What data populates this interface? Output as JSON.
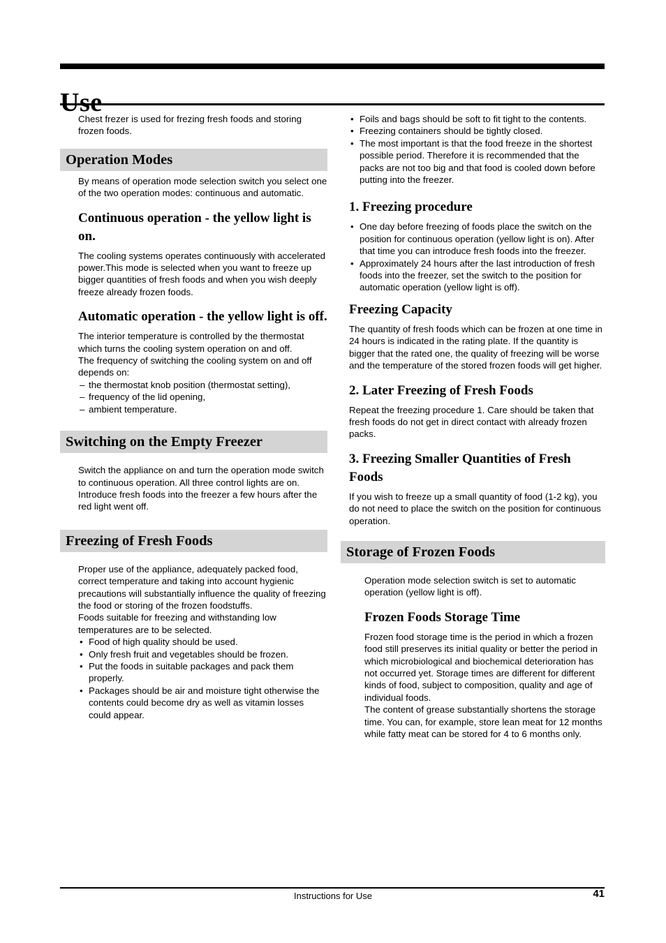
{
  "document": {
    "title": "Use",
    "footer": {
      "center": "Instructions for Use",
      "page_number": "41"
    }
  },
  "left_column": {
    "intro": "Chest frezer is used for frezing fresh foods and storing frozen foods.",
    "section_operation_modes": {
      "heading": "Operation Modes",
      "intro": "By means of operation mode selection switch you select one of the two operation modes: continuous and automatic.",
      "sub_continuous": {
        "heading": "Continuous operation - the yellow light is on.",
        "body": "The cooling systems operates continuously with accelerated power.This mode is selected when you want to freeze up bigger quantities of fresh foods and when you wish deeply freeze already frozen foods."
      },
      "sub_automatic": {
        "heading": "Automatic operation - the yellow light is off.",
        "body_1": "The interior temperature is controlled by the thermostat which turns the cooling system operation on and off.",
        "body_2": "The frequency of switching the cooling system on and off depends on:",
        "dashes": [
          "the thermostat knob position (thermostat setting),",
          "frequency of the lid opening,",
          "ambient temperature."
        ]
      }
    },
    "section_switching_on": {
      "heading": "Switching on the Empty Freezer",
      "body": "Switch the appliance on and turn the operation mode switch to continuous operation. All three control lights are on. Introduce fresh foods into the freezer a few hours after the red light went off."
    },
    "section_freezing_fresh": {
      "heading": "Freezing of Fresh Foods",
      "body_1": "Proper use of the appliance, adequately packed food, correct temperature and taking into account hygienic precautions will substantially influence the quality of freezing the food or storing of the frozen foodstuffs.",
      "body_2": "Foods suitable for freezing and withstanding low temperatures are to be selected.",
      "bullets": [
        "Food of high quality should be used.",
        "Only fresh fruit and vegetables should be frozen.",
        "Put the foods in suitable packages and pack them properly.",
        "Packages should be air and moisture tight otherwise the contents could become dry as well as vitamin losses could appear."
      ]
    }
  },
  "right_column": {
    "top_bullets": [
      "Foils and bags should be soft to fit tight to the contents.",
      "Freezing containers should be tightly closed.",
      "The most important is that the food freeze in the shortest possible period. Therefore it is recommended that the packs are not too big and that food is cooled down before putting into the freezer."
    ],
    "section_freezing_procedure": {
      "heading": "1. Freezing procedure",
      "bullets": [
        "One day before freezing of foods place the switch on the position for continuous operation (yellow light is on). After that time you can introduce fresh foods into the freezer.",
        "Approximately 24 hours after the last introduction of fresh foods into the freezer, set the switch to the position for automatic operation (yellow light is off)."
      ]
    },
    "section_freezing_capacity": {
      "heading": "Freezing Capacity",
      "body": "The quantity of fresh foods  which can be frozen at one time in 24 hours is  indicated in the rating plate. If the quantity is bigger that the rated one, the quality of freezing will be worse and the temperature of the stored frozen foods will get higher."
    },
    "section_later_freezing": {
      "heading": "2. Later Freezing of Fresh Foods",
      "body": "Repeat the freezing procedure 1. Care should be taken that fresh foods do not get in direct contact with already frozen packs."
    },
    "section_smaller_quantities": {
      "heading": "3. Freezing Smaller Quantities of Fresh Foods",
      "body": "If you wish to freeze up a small quantity of food (1-2 kg), you do not need to place the switch on the position for continuous operation."
    },
    "section_storage": {
      "heading": "Storage of Frozen Foods",
      "body": "Operation mode selection switch is set to automatic operation (yellow light is off).",
      "sub_storage_time": {
        "heading": "Frozen Foods Storage Time",
        "body_1": "Frozen food storage time is the period in which a frozen food still preserves its initial quality or better the period in which microbiological and biochemical deterioration has not occurred yet. Storage times are different for different kinds of food, subject to composition, quality and age of individual foods.",
        "body_2": "The content of grease substantially shortens the storage time. You can, for example, store lean meat for 12 months while fatty meat can be stored for 4 to 6 months only."
      }
    }
  }
}
